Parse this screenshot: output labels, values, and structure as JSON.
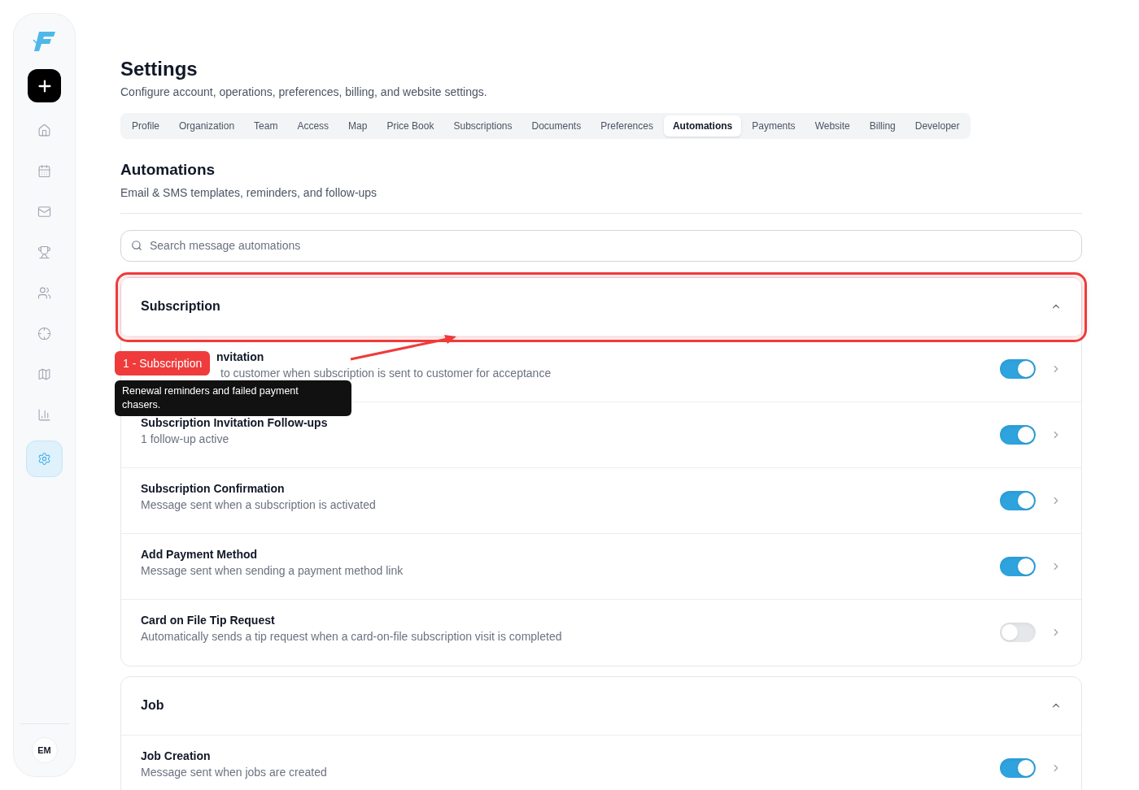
{
  "sidebar": {
    "items": [
      {
        "kind": "home",
        "selected": false
      },
      {
        "kind": "calendar",
        "selected": false
      },
      {
        "kind": "mail",
        "selected": false
      },
      {
        "kind": "trophy",
        "selected": false
      },
      {
        "kind": "users",
        "selected": false
      },
      {
        "kind": "target",
        "selected": false
      },
      {
        "kind": "map",
        "selected": false
      },
      {
        "kind": "chart",
        "selected": false
      },
      {
        "kind": "settings",
        "selected": true
      }
    ],
    "avatar": "EM"
  },
  "page": {
    "title": "Settings",
    "subtitle": "Configure account, operations, preferences, billing, and website settings."
  },
  "tabs": [
    {
      "label": "Profile",
      "selected": false
    },
    {
      "label": "Organization",
      "selected": false
    },
    {
      "label": "Team",
      "selected": false
    },
    {
      "label": "Access",
      "selected": false
    },
    {
      "label": "Map",
      "selected": false
    },
    {
      "label": "Price Book",
      "selected": false
    },
    {
      "label": "Subscriptions",
      "selected": false
    },
    {
      "label": "Documents",
      "selected": false
    },
    {
      "label": "Preferences",
      "selected": false
    },
    {
      "label": "Automations",
      "selected": true
    },
    {
      "label": "Payments",
      "selected": false
    },
    {
      "label": "Website",
      "selected": false
    },
    {
      "label": "Billing",
      "selected": false
    },
    {
      "label": "Developer",
      "selected": false
    }
  ],
  "section": {
    "title": "Automations",
    "subtitle": "Email & SMS templates, reminders, and follow-ups"
  },
  "search": {
    "placeholder": "Search message automations"
  },
  "groups": [
    {
      "title": "Subscription",
      "expanded": true,
      "highlighted": true,
      "rows": [
        {
          "title": "nvitation",
          "description": "to customer when subscription is sent to customer for acceptance",
          "covered": true,
          "on": true
        },
        {
          "title": "Subscription Invitation Follow-ups",
          "description": "1 follow-up active",
          "covered": false,
          "on": true
        },
        {
          "title": "Subscription Confirmation",
          "description": "Message sent when a subscription is activated",
          "covered": false,
          "on": true
        },
        {
          "title": "Add Payment Method",
          "description": "Message sent when sending a payment method link",
          "covered": false,
          "on": true
        },
        {
          "title": "Card on File Tip Request",
          "description": "Automatically sends a tip request when a card-on-file subscription visit is completed",
          "covered": false,
          "on": false
        }
      ]
    },
    {
      "title": "Job",
      "expanded": true,
      "highlighted": false,
      "rows": [
        {
          "title": "Job Creation",
          "description": "Message sent when jobs are created",
          "covered": false,
          "on": true
        }
      ]
    }
  ],
  "annotation": {
    "badge": "1 - Subscription",
    "tooltip": "Renewal reminders and failed payment chasers."
  }
}
